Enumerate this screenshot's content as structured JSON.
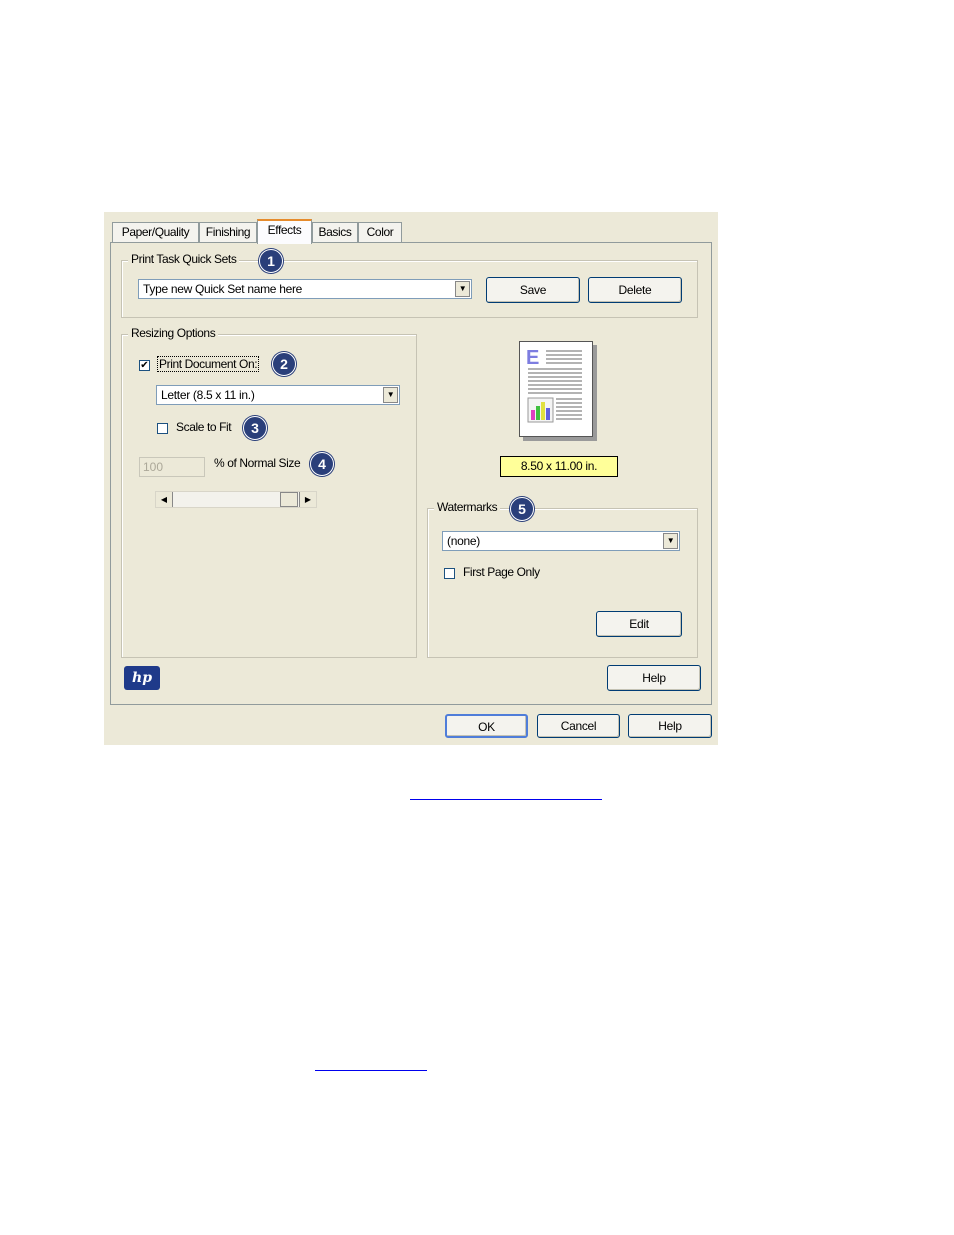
{
  "tabs": [
    "Paper/Quality",
    "Finishing",
    "Effects",
    "Basics",
    "Color"
  ],
  "active_tab": "Effects",
  "quick_sets": {
    "legend": "Print Task Quick Sets",
    "callout": "1",
    "combo_value": "Type new Quick Set name here",
    "save_label": "Save",
    "delete_label": "Delete"
  },
  "resizing": {
    "legend": "Resizing Options",
    "print_document_on_label": "Print Document On:",
    "print_document_on_checked": true,
    "callout_print_on": "2",
    "paper_size_value": "Letter (8.5 x 11 in.)",
    "scale_to_fit_label": "Scale to Fit",
    "scale_to_fit_checked": false,
    "callout_scale": "3",
    "percent_value": "100",
    "percent_label": "% of Normal Size",
    "callout_percent": "4"
  },
  "preview": {
    "size_label": "8.50 x 11.00 in."
  },
  "watermarks": {
    "legend": "Watermarks",
    "callout": "5",
    "combo_value": "(none)",
    "first_page_only_label": "First Page Only",
    "first_page_only_checked": false,
    "edit_label": "Edit"
  },
  "logo_text": "hp",
  "panel_help_label": "Help",
  "footer": {
    "ok_label": "OK",
    "cancel_label": "Cancel",
    "help_label": "Help"
  },
  "colors": {
    "dialog_bg": "#ece9d8",
    "callout_bg": "#2a3f7a",
    "preview_label_bg": "#ffff99",
    "link": "#0000ee"
  }
}
